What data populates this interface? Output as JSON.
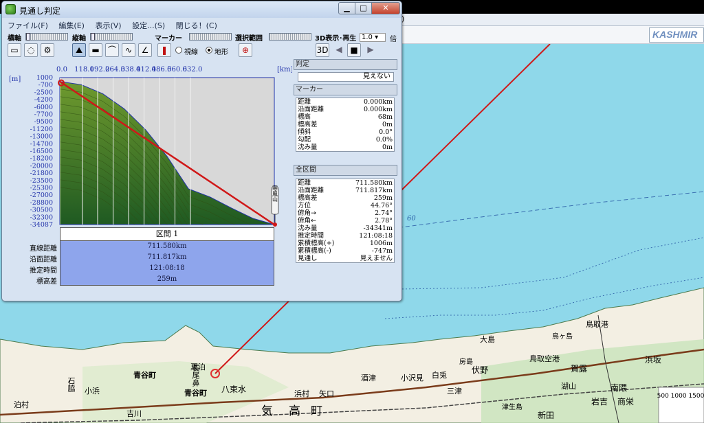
{
  "window": {
    "title": "見通し判定",
    "min_glyph": "▁",
    "max_glyph": "□",
    "close_glyph": "✕"
  },
  "menu": [
    {
      "label": "ファイル(F)"
    },
    {
      "label": "編集(E)"
    },
    {
      "label": "表示(V)"
    },
    {
      "label": "設定...(S)"
    },
    {
      "label": "閉じる！(C)"
    }
  ],
  "toolbar": {
    "horizontal_axis_label": "横軸",
    "vertical_axis_label": "縦軸",
    "marker_label": "マーカー",
    "selection_label": "選択範囲",
    "playback_label": "3D表示･再生",
    "speed_value": "1.0",
    "speed_unit": "倍",
    "radio_sightline": "視線",
    "radio_terrain": "地形",
    "radio_selected": "terrain"
  },
  "chart": {
    "x_unit": "[km]",
    "y_unit": "[m]",
    "x_ticks": [
      "0.0",
      "118.0",
      "192.0",
      "264.0",
      "338.0",
      "412.0",
      "486.0",
      "560.0",
      "632.0"
    ],
    "y_ticks": [
      "1000",
      "-700",
      "-2500",
      "-4200",
      "-6000",
      "-7700",
      "-9500",
      "-11200",
      "-13000",
      "-14700",
      "-16500",
      "-18200",
      "-20000",
      "-21800",
      "-23500",
      "-25300",
      "-27000",
      "-28800",
      "-30500",
      "-32300",
      "-34087"
    ],
    "end_marker_text": "寒風山",
    "colors": {
      "terrain_top": "#6f9a2e",
      "terrain_bottom": "#1f5a22",
      "line": "#d01818",
      "grid": "#2233aa"
    }
  },
  "chart_data": {
    "type": "area",
    "title": "",
    "xlabel": "[km]",
    "ylabel": "[m]",
    "xlim": [
      0,
      711.58
    ],
    "ylim": [
      -34087,
      1000
    ],
    "x": [
      0,
      71.2,
      142.3,
      213.5,
      284.6,
      355.8,
      426.9,
      498.1,
      569.3,
      640.4,
      711.58
    ],
    "series": [
      {
        "name": "",
        "values": [
          68,
          -690,
          -2850,
          -6450,
          -11450,
          -17800,
          -25550,
          -27500,
          -30150,
          -32600,
          -34087
        ]
      },
      {
        "name": "",
        "values": [
          68,
          -3300,
          -6700,
          -10100,
          -13500,
          -16950,
          -20350,
          -23800,
          -27200,
          -30650,
          -34087
        ]
      }
    ]
  },
  "section": {
    "header": "区間 1",
    "rows": [
      {
        "label": "直線距離",
        "value": "711.580km"
      },
      {
        "label": "沿面距離",
        "value": "711.817km"
      },
      {
        "label": "推定時間",
        "value": "121:08:18"
      },
      {
        "label": "標高差",
        "value": "259m"
      }
    ]
  },
  "info": {
    "judge_header": "判定",
    "judge_value": "見えない",
    "marker_header": "マーカー",
    "marker_rows": [
      {
        "label": "距離",
        "value": "0.000km"
      },
      {
        "label": "沿面距離",
        "value": "0.000km"
      },
      {
        "label": "標高",
        "value": "68m"
      },
      {
        "label": "標高差",
        "value": "0m"
      },
      {
        "label": "傾斜",
        "value": "0.0°"
      },
      {
        "label": "勾配",
        "value": "0.0%"
      },
      {
        "label": "沈み量",
        "value": "0m"
      }
    ],
    "total_header": "全区間",
    "total_rows": [
      {
        "label": "距離",
        "value": "711.580km"
      },
      {
        "label": "沿面距離",
        "value": "711.817km"
      },
      {
        "label": "標高差",
        "value": "259m"
      },
      {
        "label": "方位",
        "value": "44.76°"
      },
      {
        "label": "俯角→",
        "value": "2.74°"
      },
      {
        "label": "俯角←",
        "value": "2.78°"
      },
      {
        "label": "沈み量",
        "value": "-34341m"
      },
      {
        "label": "推定時間",
        "value": "121:08:18"
      },
      {
        "label": "累積標高(+)",
        "value": "1006m"
      },
      {
        "label": "累積標高(-)",
        "value": "-747m"
      },
      {
        "label": "見通し",
        "value": "見えません"
      }
    ]
  },
  "map": {
    "menubar_fragment": ")",
    "title_box": "KASHMIR",
    "depth_label": "60",
    "labels": [
      {
        "text": "青谷町",
        "size": 15
      },
      {
        "text": "青谷町",
        "size": 15
      },
      {
        "text": "泊村",
        "size": 15
      },
      {
        "text": "気",
        "size": 17
      },
      {
        "text": "高",
        "size": 17
      },
      {
        "text": "町",
        "size": 17
      },
      {
        "text": "鳥取港",
        "size": 11
      },
      {
        "text": "鳥取空港",
        "size": 11
      },
      {
        "text": "賀露",
        "size": 12
      },
      {
        "text": "浜坂",
        "size": 12
      },
      {
        "text": "南隈",
        "size": 12
      },
      {
        "text": "岩吉",
        "size": 12
      },
      {
        "text": "商栄",
        "size": 12
      },
      {
        "text": "大島",
        "size": 11
      },
      {
        "text": "鳥ヶ島",
        "size": 10
      },
      {
        "text": "長尾鼻",
        "size": 11
      },
      {
        "text": "夏泊",
        "size": 11
      },
      {
        "text": "八束水",
        "size": 12
      },
      {
        "text": "浜村",
        "size": 11
      },
      {
        "text": "矢口",
        "size": 11
      },
      {
        "text": "酒津",
        "size": 11
      },
      {
        "text": "小沢見",
        "size": 11
      },
      {
        "text": "白兎",
        "size": 11
      },
      {
        "text": "伏野",
        "size": 12
      },
      {
        "text": "新田",
        "size": 12
      },
      {
        "text": "吉川",
        "size": 11
      },
      {
        "text": "小浜",
        "size": 11
      },
      {
        "text": "石脇",
        "size": 11
      },
      {
        "text": "三津",
        "size": 11
      },
      {
        "text": "湖山",
        "size": 11
      },
      {
        "text": "津生島",
        "size": 10
      },
      {
        "text": "房島",
        "size": 10
      }
    ]
  }
}
